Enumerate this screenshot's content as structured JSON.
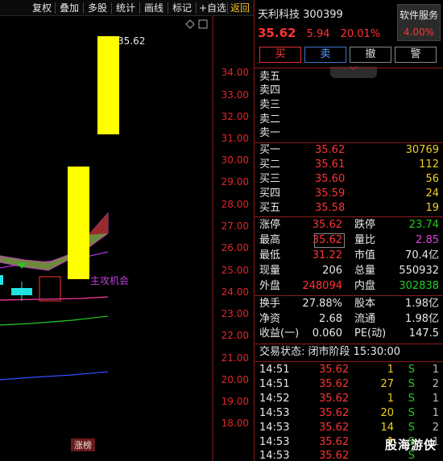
{
  "toolbar": {
    "items": [
      "复权",
      "叠加",
      "多股",
      "统计",
      "画线",
      "标记",
      "+自选",
      "返回"
    ]
  },
  "chart": {
    "price_labels": [
      "34.00",
      "33.00",
      "32.00",
      "31.00",
      "30.00",
      "29.00",
      "28.00",
      "27.00",
      "26.00",
      "25.00",
      "24.00",
      "23.00",
      "22.00",
      "21.00",
      "20.00",
      "19.00",
      "18.00"
    ],
    "max_label": "35.62",
    "annotation": "主攻机会",
    "bottom_tag": "涨榜"
  },
  "stock": {
    "name": "天利科技",
    "code": "300399",
    "price": "35.62",
    "change": "5.94",
    "change_pct": "20.01%"
  },
  "service": {
    "label": "软件服务",
    "value": "4.00%"
  },
  "buttons": {
    "buy": "买",
    "sell": "卖",
    "cancel": "撤",
    "alert": "警"
  },
  "collapse_icon": "chevron-double-down-icon",
  "asks": [
    {
      "label": "卖五",
      "price": "",
      "volume": ""
    },
    {
      "label": "卖四",
      "price": "",
      "volume": ""
    },
    {
      "label": "卖三",
      "price": "",
      "volume": ""
    },
    {
      "label": "卖二",
      "price": "",
      "volume": ""
    },
    {
      "label": "卖一",
      "price": "",
      "volume": ""
    }
  ],
  "bids": [
    {
      "label": "买一",
      "price": "35.62",
      "volume": "30769"
    },
    {
      "label": "买二",
      "price": "35.61",
      "volume": "112"
    },
    {
      "label": "买三",
      "price": "35.60",
      "volume": "56"
    },
    {
      "label": "买四",
      "price": "35.59",
      "volume": "24"
    },
    {
      "label": "买五",
      "price": "35.58",
      "volume": "19"
    }
  ],
  "quote": [
    {
      "l_label": "涨停",
      "l_value": "35.62",
      "r_label": "跌停",
      "r_value": "23.74"
    },
    {
      "l_label": "最高",
      "l_value": "35.62",
      "r_label": "量比",
      "r_value": "2.85"
    },
    {
      "l_label": "最低",
      "l_value": "31.22",
      "r_label": "市值",
      "r_value": "70.4亿"
    },
    {
      "l_label": "现量",
      "l_value": "206",
      "r_label": "总量",
      "r_value": "550932"
    },
    {
      "l_label": "外盘",
      "l_value": "248094",
      "r_label": "内盘",
      "r_value": "302838"
    }
  ],
  "fundamentals": [
    {
      "l_label": "换手",
      "l_value": "27.88%",
      "r_label": "股本",
      "r_value": "1.98亿"
    },
    {
      "l_label": "净资",
      "l_value": "2.68",
      "r_label": "流通",
      "r_value": "1.98亿"
    },
    {
      "l_label": "收益(一)",
      "l_value": "0.060",
      "r_label": "PE(动)",
      "r_value": "147.5"
    }
  ],
  "trade_status": "交易状态: 闭市阶段 15:30:00",
  "ticks": [
    {
      "time": "14:51",
      "price": "35.62",
      "volume": "1",
      "side": "S",
      "count": "1"
    },
    {
      "time": "14:51",
      "price": "35.62",
      "volume": "27",
      "side": "S",
      "count": "2"
    },
    {
      "time": "14:52",
      "price": "35.62",
      "volume": "1",
      "side": "S",
      "count": "1"
    },
    {
      "time": "14:53",
      "price": "35.62",
      "volume": "20",
      "side": "S",
      "count": "1"
    },
    {
      "time": "14:53",
      "price": "35.62",
      "volume": "14",
      "side": "S",
      "count": "2"
    },
    {
      "time": "14:53",
      "price": "35.62",
      "volume": "1",
      "side": "S",
      "count": "1"
    },
    {
      "time": "14:53",
      "price": "35.62",
      "volume": "",
      "side": "S",
      "count": ""
    }
  ],
  "watermark": "股海游侠",
  "colors": {
    "up": "#ff3333",
    "down": "#22cc22",
    "signal": "#ffff00",
    "accent": "#f0c020"
  }
}
